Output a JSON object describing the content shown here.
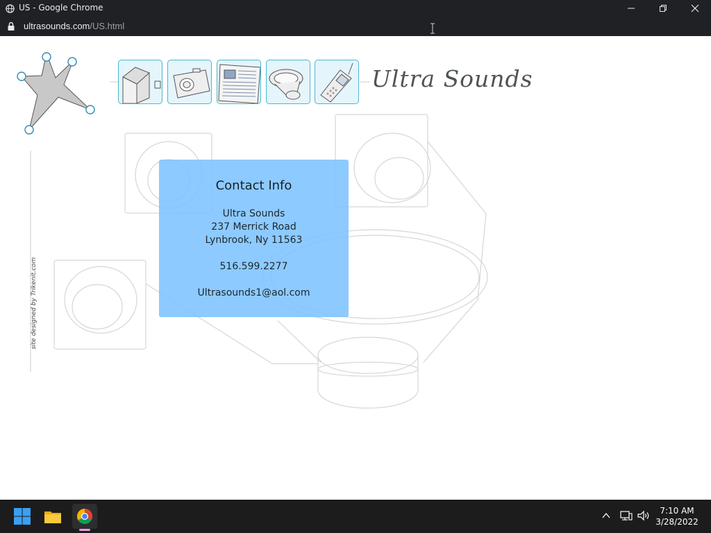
{
  "window": {
    "title": "US - Google Chrome",
    "controls": [
      "minimize-icon",
      "restore-icon",
      "close-icon"
    ]
  },
  "address_bar": {
    "host": "ultrasounds.com",
    "path": "/US.html",
    "lock_icon": "lock-icon"
  },
  "page": {
    "logo_text": "Ultra Sounds",
    "nav_icons": [
      "house-icon",
      "camera-icon",
      "newspaper-icon",
      "speaker-icon",
      "cellphone-icon"
    ],
    "credit": "site designed by Trikenit.com",
    "contact": {
      "heading": "Contact Info",
      "name": "Ultra Sounds",
      "street": "237 Merrick Road",
      "city": "Lynbrook, Ny 11563",
      "phone": "516.599.2277",
      "email": "Ultrasounds1@aol.com",
      "background": "#7dc3ff"
    },
    "accent_color": "#4bb6cf"
  },
  "taskbar": {
    "apps": [
      "windows-start-icon",
      "file-explorer-icon",
      "chrome-icon"
    ],
    "tray_icons": [
      "chevron-up-icon",
      "network-icon",
      "volume-icon"
    ],
    "time": "7:10 AM",
    "date": "3/28/2022"
  }
}
